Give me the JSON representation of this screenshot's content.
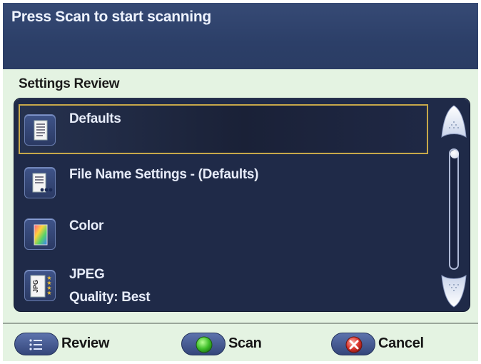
{
  "header": {
    "title": "Press Scan to start scanning"
  },
  "section": {
    "title": "Settings Review"
  },
  "settings_list": {
    "items": [
      {
        "label": "Defaults",
        "icon": "document-icon",
        "selected": true
      },
      {
        "label": "File Name Settings - (Defaults)",
        "icon": "file-name-icon"
      },
      {
        "label": "Color",
        "icon": "color-gradient-icon"
      },
      {
        "label": "JPEG",
        "sublabel": "Quality: Best",
        "icon": "jpeg-quality-icon"
      }
    ]
  },
  "footer": {
    "review_label": "Review",
    "scan_label": "Scan",
    "cancel_label": "Cancel"
  },
  "colors": {
    "header_bg": "#2c3f68",
    "list_bg": "#1f2a48",
    "selection_border": "#c7a84a",
    "footer_bg": "#e4f3e2",
    "scan_green": "#3fbf2a",
    "cancel_red": "#d9322a"
  }
}
